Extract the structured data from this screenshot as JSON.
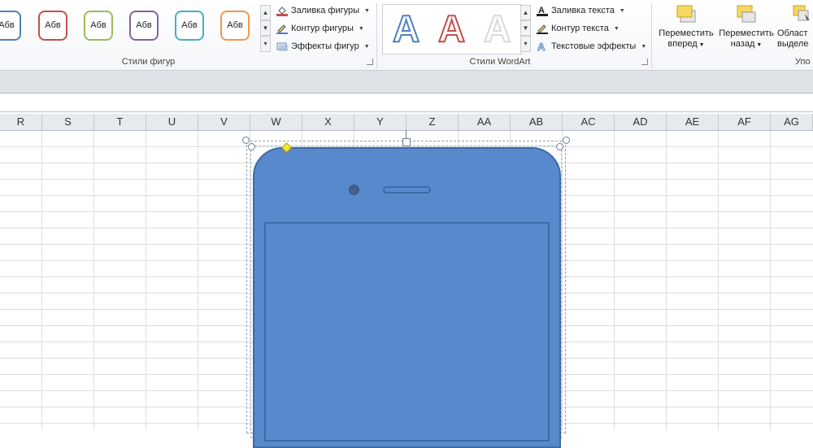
{
  "ribbon": {
    "shape_styles": {
      "label": "Стили фигур",
      "tiles": [
        {
          "text": "Абв",
          "color": "#4f81bd"
        },
        {
          "text": "Абв",
          "color": "#c0504d"
        },
        {
          "text": "Абв",
          "color": "#9bbb59"
        },
        {
          "text": "Абв",
          "color": "#8064a2"
        },
        {
          "text": "Абв",
          "color": "#4bacc6"
        },
        {
          "text": "Абв",
          "color": "#f79646"
        }
      ],
      "commands": {
        "fill": "Заливка фигуры",
        "outline": "Контур фигуры",
        "effects": "Эффекты фигур"
      }
    },
    "wordart": {
      "label": "Стили WordArt",
      "letters": [
        {
          "char": "A",
          "color": "#4f81bd"
        },
        {
          "char": "A",
          "color": "#c0504d"
        },
        {
          "char": "A",
          "color": "#d9d9d9"
        }
      ],
      "commands": {
        "text_fill": "Заливка текста",
        "text_outline": "Контур текста",
        "text_effects": "Текстовые эффекты"
      }
    },
    "arrange": {
      "label": "Упо",
      "bring_forward": [
        "Переместить",
        "вперед"
      ],
      "send_backward": [
        "Переместить",
        "назад"
      ],
      "selection_pane": [
        "Област",
        "выделе"
      ]
    }
  },
  "columns": [
    "R",
    "S",
    "T",
    "U",
    "V",
    "W",
    "X",
    "Y",
    "Z",
    "AA",
    "AB",
    "AC",
    "AD",
    "AE",
    "AF",
    "AG"
  ],
  "colors": {
    "shape_fill": "#5789cc",
    "shape_outline": "#3d6aa8"
  }
}
